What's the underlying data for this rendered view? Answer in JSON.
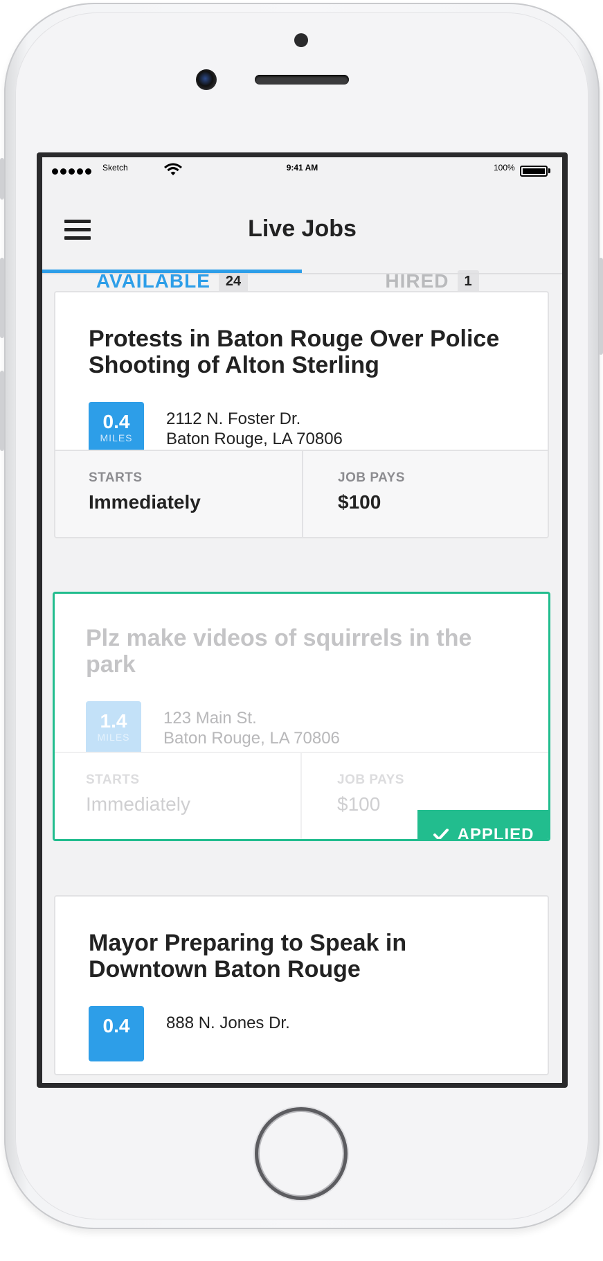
{
  "status_bar": {
    "carrier": "Sketch",
    "time": "9:41 AM",
    "battery": "100%"
  },
  "header": {
    "title": "Live Jobs"
  },
  "tabs": [
    {
      "label": "AVAILABLE",
      "count": "24",
      "active": true
    },
    {
      "label": "HIRED",
      "count": "1",
      "active": false
    }
  ],
  "jobs": [
    {
      "title": "Protests in Baton Rouge Over Police Shooting of Alton Sterling",
      "distance": "0.4",
      "distance_unit": "MILES",
      "address_line1": "2112 N. Foster Dr.",
      "address_line2": "Baton Rouge, LA 70806",
      "starts_label": "STARTS",
      "starts_value": "Immediately",
      "pays_label": "JOB PAYS",
      "pays_value": "$100"
    },
    {
      "title": "Plz make videos of squirrels in the park",
      "distance": "1.4",
      "distance_unit": "MILES",
      "address_line1": "123 Main St.",
      "address_line2": "Baton Rouge, LA 70806",
      "starts_label": "STARTS",
      "starts_value": "Immediately",
      "pays_label": "JOB PAYS",
      "pays_value": "$100",
      "status": "APPLIED"
    },
    {
      "title": "Mayor Preparing to Speak in Downtown Baton Rouge",
      "distance": "0.4",
      "address_line1": "888 N. Jones Dr."
    }
  ],
  "colors": {
    "accent_blue": "#2d9ee8",
    "applied_green": "#22bd8e"
  }
}
